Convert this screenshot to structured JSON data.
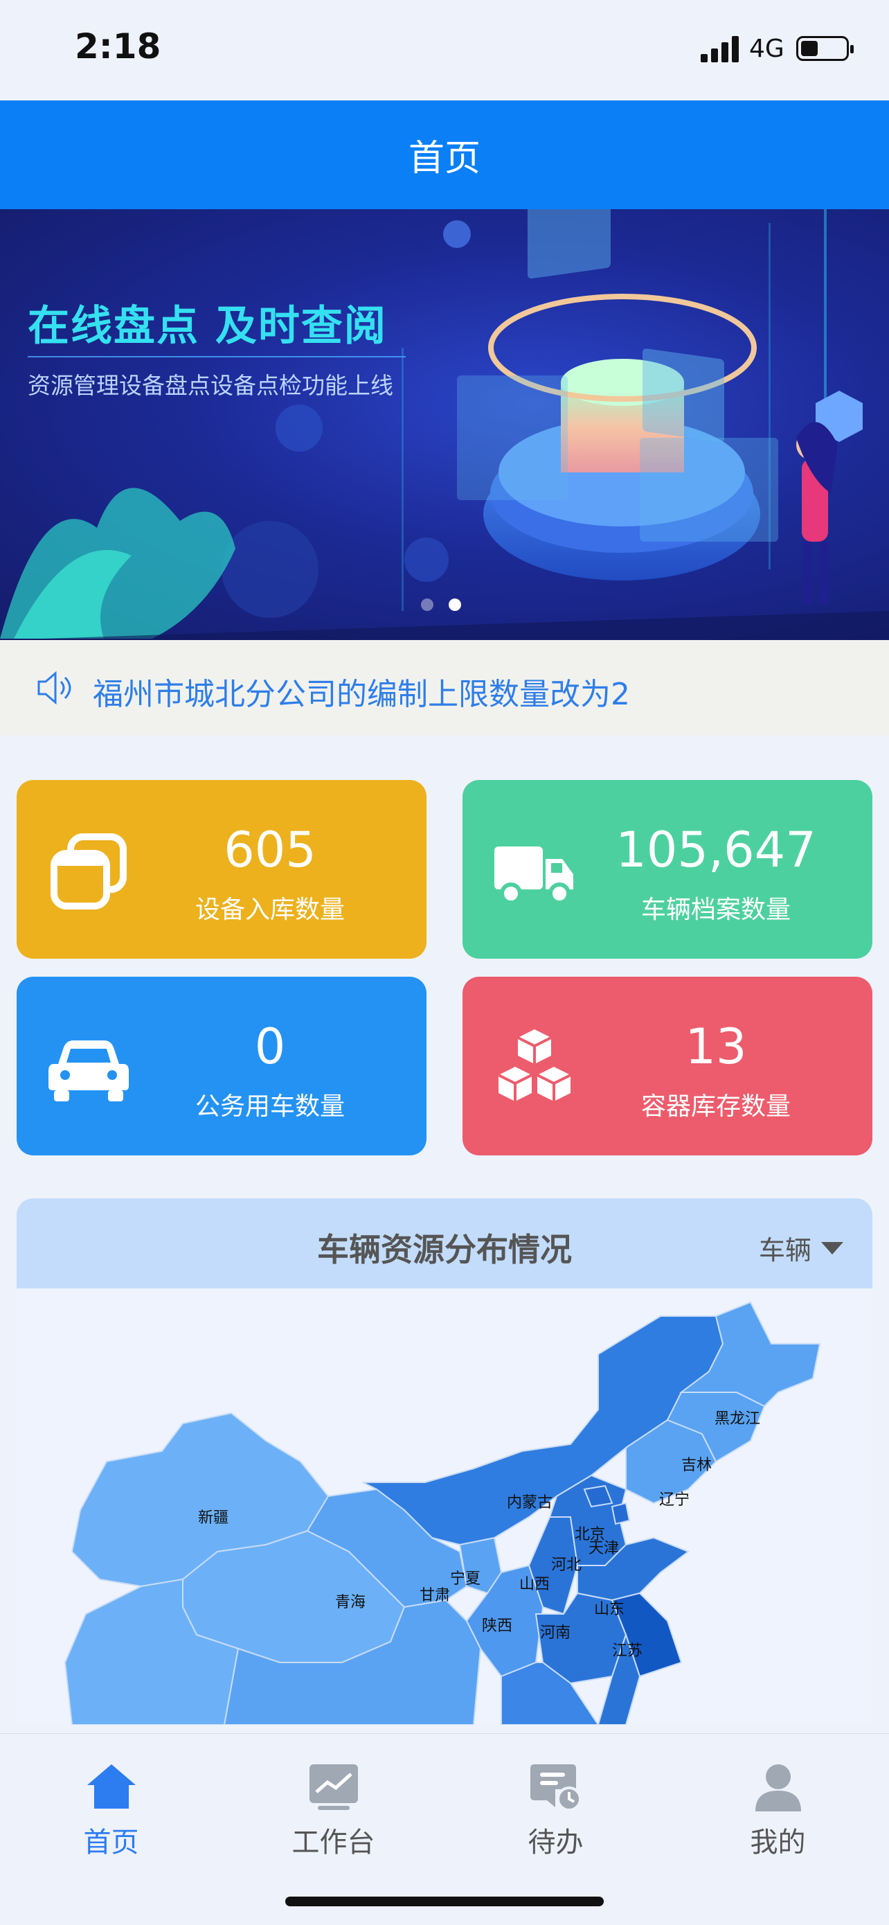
{
  "status_bar": {
    "time": "2:18",
    "network": "4G"
  },
  "header": {
    "title": "首页"
  },
  "banner": {
    "headline": "在线盘点 及时查阅",
    "subline": "资源管理设备盘点设备点检功能上线",
    "page_count": 2,
    "active_page": 2
  },
  "notice": {
    "text": "福州市城北分公司的编制上限数量改为2"
  },
  "stats": [
    {
      "value": "605",
      "label": "设备入库数量",
      "icon": "stacked-windows-icon",
      "color": "#ecb11d"
    },
    {
      "value": "105,647",
      "label": "车辆档案数量",
      "icon": "truck-icon",
      "color": "#4dd09f"
    },
    {
      "value": "0",
      "label": "公务用车数量",
      "icon": "car-icon",
      "color": "#2492f2"
    },
    {
      "value": "13",
      "label": "容器库存数量",
      "icon": "cubes-icon",
      "color": "#ec5c6c"
    }
  ],
  "distribution": {
    "title": "车辆资源分布情况",
    "filter": "车辆",
    "regions": [
      "新疆",
      "青海",
      "甘肃",
      "宁夏",
      "陕西",
      "内蒙古",
      "山西",
      "河北",
      "北京",
      "天津",
      "山东",
      "河南",
      "辽宁",
      "吉林",
      "黑龙江",
      "江苏"
    ]
  },
  "tabs": [
    {
      "label": "首页",
      "icon": "home-icon",
      "active": true
    },
    {
      "label": "工作台",
      "icon": "chart-icon",
      "active": false
    },
    {
      "label": "待办",
      "icon": "todo-clock-icon",
      "active": false
    },
    {
      "label": "我的",
      "icon": "user-icon",
      "active": false
    }
  ]
}
